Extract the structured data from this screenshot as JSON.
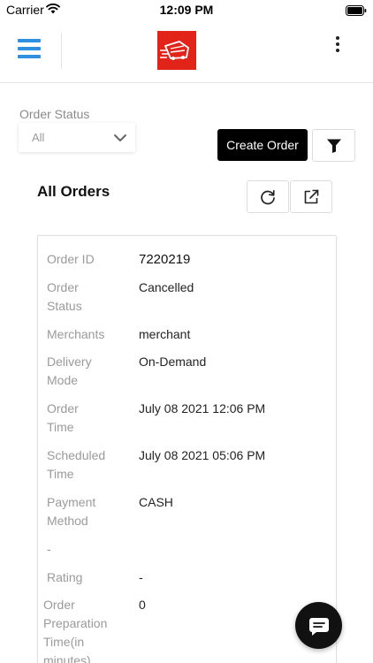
{
  "status_bar": {
    "carrier": "Carrier",
    "time": "12:09 PM"
  },
  "header": {
    "menu_icon": "hamburger-menu-icon",
    "logo_icon": "delivery-van-logo",
    "more_icon": "vertical-dots-icon",
    "logo_color": "#e2231a",
    "menu_color": "#2f8fe0"
  },
  "filters": {
    "order_status_label": "Order Status",
    "order_status_value": "All",
    "create_order_label": "Create Order",
    "filter_icon": "funnel-icon"
  },
  "orders_section": {
    "title": "All Orders",
    "refresh_icon": "refresh-icon",
    "export_icon": "external-link-icon"
  },
  "order": {
    "order_id_label": "Order ID",
    "order_id": "7220219",
    "status_label_1": "Order",
    "status_label_2": "Status",
    "status": "Cancelled",
    "merchants_label": "Merchants",
    "merchant": "merchant",
    "delivery_label_1": "Delivery",
    "delivery_label_2": "Mode",
    "delivery_mode": "On-Demand",
    "order_time_label_1": "Order",
    "order_time_label_2": "Time",
    "order_time": "July 08 2021 12:06 PM",
    "scheduled_label_1": "Scheduled",
    "scheduled_label_2": "Time",
    "scheduled_time": "July 08 2021 05:06 PM",
    "payment_label_1": "Payment",
    "payment_label_2": "Method",
    "payment_method": "CASH",
    "dash_label": "-",
    "rating_label": "Rating",
    "rating": "-",
    "prep_label_1": "Order",
    "prep_label_2": "Preparation",
    "prep_label_3": "Time(in",
    "prep_label_4": "minutes)",
    "prep_time": "0"
  },
  "chat": {
    "icon": "chat-bubble-icon"
  }
}
